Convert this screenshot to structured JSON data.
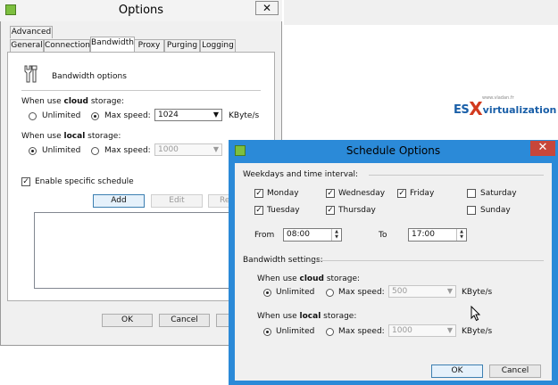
{
  "options_window": {
    "title": "Options",
    "close_glyph": "✕",
    "tabs_row1": [
      "Advanced"
    ],
    "tabs_row2": [
      "General",
      "Connection",
      "Bandwidth",
      "Proxy",
      "Purging",
      "Logging"
    ],
    "active_tab": "Bandwidth",
    "section_title": "Bandwidth options",
    "section_icon": "wrench-icon",
    "cloud": {
      "prefix": "When use",
      "bold": "cloud",
      "suffix": "storage:",
      "unlimited_label": "Unlimited",
      "maxspeed_label": "Max speed:",
      "selected": "maxspeed",
      "speed_value": "1024",
      "unit": "KByte/s"
    },
    "local": {
      "prefix": "When use",
      "bold": "local",
      "suffix": "storage:",
      "unlimited_label": "Unlimited",
      "maxspeed_label": "Max speed:",
      "selected": "unlimited",
      "speed_value": "1000"
    },
    "enable_schedule_label": "Enable specific schedule",
    "enable_schedule_checked": true,
    "buttons": {
      "add": "Add",
      "edit": "Edit",
      "remove": "Re"
    },
    "ok": "OK",
    "cancel": "Cancel"
  },
  "logo": {
    "es": "ES",
    "x": "X",
    "rest": "virtualization",
    "small": "www.vladan.fr"
  },
  "schedule_window": {
    "title": "Schedule Options",
    "close_glyph": "✕",
    "weekdays_group": "Weekdays and time interval:",
    "days": [
      {
        "label": "Monday",
        "checked": true
      },
      {
        "label": "Wednesday",
        "checked": true
      },
      {
        "label": "Friday",
        "checked": true
      },
      {
        "label": "Saturday",
        "checked": false
      },
      {
        "label": "Tuesday",
        "checked": true
      },
      {
        "label": "Thursday",
        "checked": true
      },
      {
        "label": "Sunday",
        "checked": false
      }
    ],
    "from_label": "From",
    "from_value": "08:00",
    "to_label": "To",
    "to_value": "17:00",
    "bandwidth_group": "Bandwidth settings:",
    "cloud": {
      "prefix": "When use",
      "bold": "cloud",
      "suffix": "storage:",
      "unlimited_label": "Unlimited",
      "maxspeed_label": "Max speed:",
      "selected": "unlimited",
      "speed_value": "500",
      "unit": "KByte/s"
    },
    "local": {
      "prefix": "When use",
      "bold": "local",
      "suffix": "storage:",
      "unlimited_label": "Unlimited",
      "maxspeed_label": "Max speed:",
      "selected": "unlimited",
      "speed_value": "1000",
      "unit": "KByte/s"
    },
    "ok": "OK",
    "cancel": "Cancel"
  },
  "colors": {
    "title_bar_active": "#2b8ad8",
    "close_button": "#c7463a",
    "app_icon": "#7dbf3f"
  }
}
